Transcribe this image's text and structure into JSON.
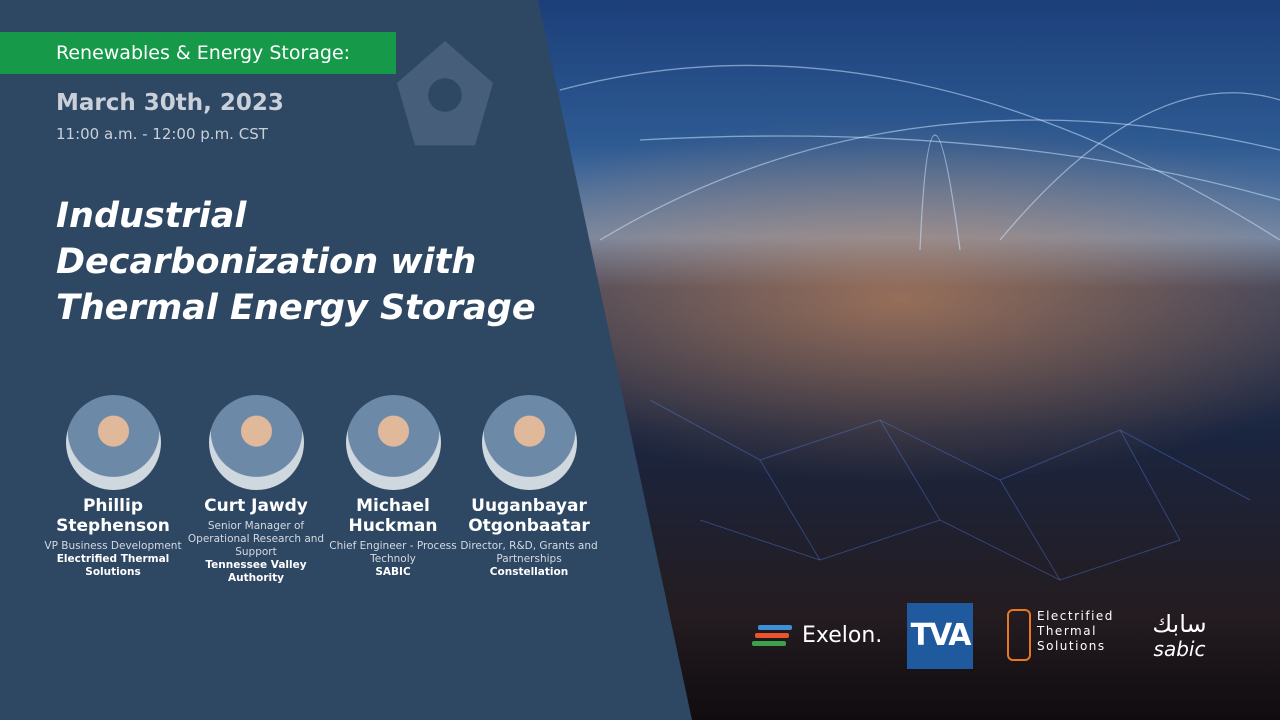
{
  "banner": "Renewables & Energy Storage:",
  "date": "March 30th, 2023",
  "time": "11:00 a.m. - 12:00 p.m. CST",
  "title": "Industrial Decarbonization with Thermal Energy Storage",
  "speakers": [
    {
      "name": "Phillip Stephenson",
      "role": "VP Business Development",
      "org": "Electrified Thermal Solutions"
    },
    {
      "name": "Curt Jawdy",
      "role": "Senior Manager of Operational Research and Support",
      "org": "Tennessee Valley Authority"
    },
    {
      "name": "Michael Huckman",
      "role": "Chief Engineer - Process Technoly",
      "org": "SABIC"
    },
    {
      "name": "Uuganbayar Otgonbaatar",
      "role": "Director, R&D, Grants and Partnerships",
      "org": "Constellation"
    }
  ],
  "logos": {
    "exelon": "Exelon.",
    "tva": "TVA",
    "ets": [
      "Electrified",
      "Thermal",
      "Solutions"
    ],
    "sabic_ar": "سابك",
    "sabic_en": "sabic"
  }
}
